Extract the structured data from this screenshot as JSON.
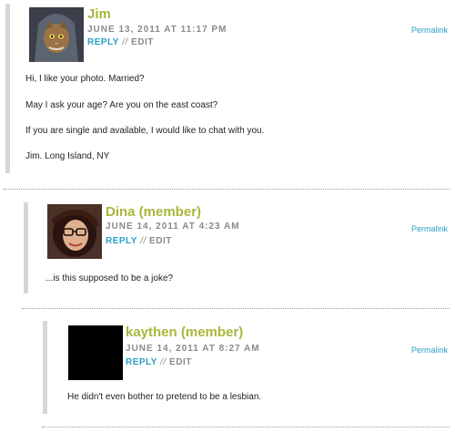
{
  "comments": [
    {
      "author": "Jim",
      "date": "JUNE 13, 2011 AT 11:17 PM",
      "reply_label": "REPLY",
      "separator": "//",
      "edit_label": "EDIT",
      "permalink": "Permalink",
      "avatar_icon": "hooded-cat-avatar",
      "lines": [
        "Hi, I like your photo. Married?",
        "May I ask your age? Are you on the east coast?",
        "If you are single and available, I would like to chat with you.",
        "Jim. Long Island, NY"
      ]
    },
    {
      "author": "Dina (member)",
      "date": "JUNE 14, 2011 AT 4:23 AM",
      "reply_label": "REPLY",
      "separator": "//",
      "edit_label": "EDIT",
      "permalink": "Permalink",
      "avatar_icon": "woman-glasses-avatar",
      "lines": [
        "...is this supposed to be a joke?"
      ]
    },
    {
      "author": "kaythen (member)",
      "date": "JUNE 14, 2011 AT 8:27 AM",
      "reply_label": "REPLY",
      "separator": "//",
      "edit_label": "EDIT",
      "permalink": "Permalink",
      "avatar_icon": "black-avatar",
      "lines": [
        "He didn't even bother to pretend to be a lesbian."
      ]
    }
  ],
  "colors": {
    "author": "#a8b73a",
    "link": "#2aa0c7",
    "meta": "#8a8a8a",
    "bar": "#d6d6d6"
  }
}
